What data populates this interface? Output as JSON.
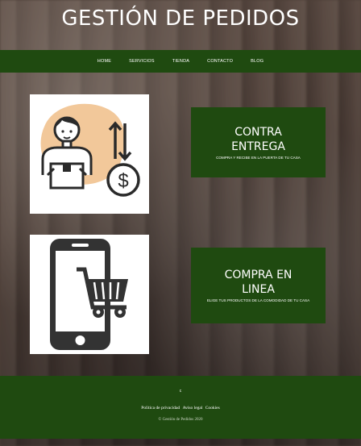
{
  "site": {
    "title": "GESTIÓN DE PEDIDOS"
  },
  "nav": {
    "items": [
      {
        "label": "HOME"
      },
      {
        "label": "SERVICIOS"
      },
      {
        "label": "TIENDA"
      },
      {
        "label": "CONTACTO"
      },
      {
        "label": "BLOG"
      }
    ]
  },
  "sections": [
    {
      "icon": "delivery-person-payment-icon",
      "title_line1": "CONTRA",
      "title_line2": "ENTREGA",
      "subtitle": "COMPRA Y RECIBE EN LA PUERTA DE TU CASA"
    },
    {
      "icon": "mobile-shopping-cart-icon",
      "title_line1": "COMPRA EN",
      "title_line2": "LINEA",
      "subtitle": "ELIGE TUS PRODUCTOS DE LA COMODIDAD DE TU CASA"
    }
  ],
  "footer": {
    "mark": "c",
    "links": [
      {
        "label": "Política de privacidad"
      },
      {
        "label": "Aviso legal"
      },
      {
        "label": "Cookies"
      }
    ],
    "copyright": "© Gestión de Pedidos 2020"
  },
  "colors": {
    "brand_green": "#1f4a10",
    "icon_peach": "#f2c89a",
    "icon_dark": "#2a2a2a"
  }
}
